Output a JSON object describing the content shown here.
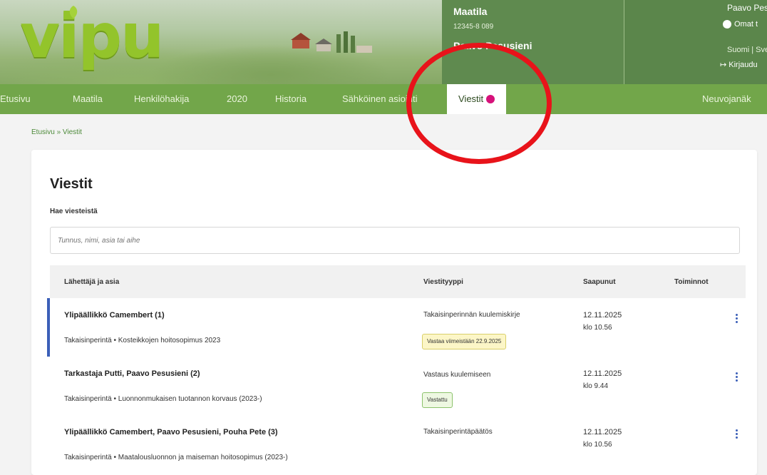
{
  "header": {
    "logo_text": "vipu",
    "farm_title": "Maatila",
    "farm_id": "12345-8 089",
    "farm_owner": "Paavo Pesusieni",
    "user_name": "Paavo Pesu",
    "own_info": "Omat t",
    "languages": "Suomi | Sve",
    "logout": "Kirjaudu"
  },
  "nav": {
    "items": [
      {
        "label": "Etusivu"
      },
      {
        "label": "Maatila"
      },
      {
        "label": "Henkilöhakija"
      },
      {
        "label": "2020"
      },
      {
        "label": "Historia"
      },
      {
        "label": "Sähköinen asiointi"
      },
      {
        "label": "Viestit"
      },
      {
        "label": "Neuvojanäk"
      }
    ],
    "active": "Viestit"
  },
  "breadcrumb": "Etusivu » Viestit",
  "main": {
    "title": "Viestit",
    "search_label": "Hae viesteistä",
    "search_placeholder": "Tunnus, nimi, asia tai aihe"
  },
  "table": {
    "headers": {
      "sender": "Lähettäjä ja asia",
      "type": "Viestityyppi",
      "received": "Saapunut",
      "actions": "Toiminnot"
    },
    "rows": [
      {
        "sender": "Ylipäällikkö Camembert  (1)",
        "subject": "Takaisinperintä • Kosteikkojen hoitosopimus 2023",
        "type": "Takaisinperinnän kuulemiskirje",
        "tag": "Vastaa viimeistään 22.9.2025",
        "date": "12.11.2025",
        "time": "klo 10.56"
      },
      {
        "sender": "Tarkastaja Putti, Paavo Pesusieni  (2)",
        "subject": "Takaisinperintä • Luonnonmukaisen tuotannon korvaus (2023-)",
        "type": "Vastaus kuulemiseen",
        "tag": "Vastattu",
        "date": "12.11.2025",
        "time": "klo 9.44"
      },
      {
        "sender": "Ylipäällikkö Camembert, Paavo Pesusieni, Pouha Pete  (3)",
        "subject": "Takaisinperintä • Maatalousluonnon ja maiseman hoitosopimus (2023-)",
        "type": "Takaisinperintäpäätös",
        "date": "12.11.2025",
        "time": "klo 10.56"
      }
    ]
  },
  "colors": {
    "nav_green": "#72a64a",
    "logo_green": "#93c42b",
    "badge": "#d6117a",
    "annotation": "#e8131a",
    "accent_blue": "#3b5fb8"
  }
}
